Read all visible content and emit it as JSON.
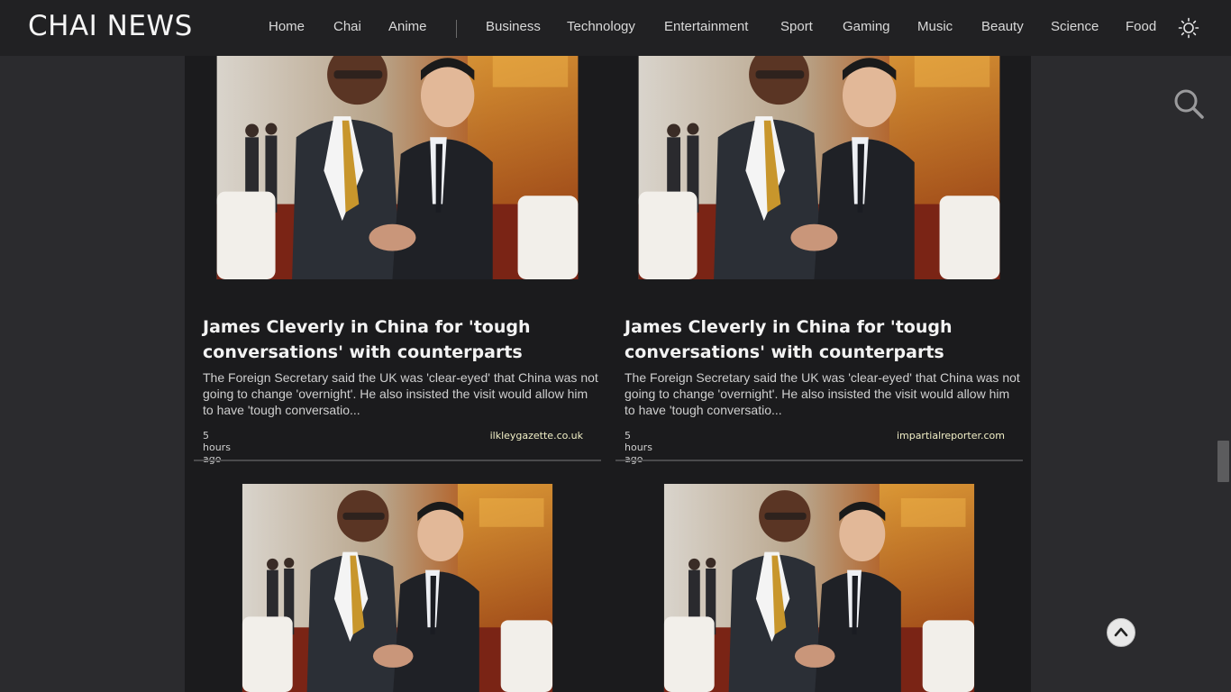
{
  "header": {
    "logo": "CHAI NEWS",
    "nav": [
      {
        "label": "Home"
      },
      {
        "label": "Chai"
      },
      {
        "label": "Anime"
      },
      {
        "label": "Business"
      },
      {
        "label": "Technology"
      },
      {
        "label": "Entertainment"
      },
      {
        "label": "Sport"
      },
      {
        "label": "Gaming"
      },
      {
        "label": "Music"
      },
      {
        "label": "Beauty"
      },
      {
        "label": "Science"
      },
      {
        "label": "Food"
      }
    ],
    "theme_icon": "sun-icon"
  },
  "search": {
    "icon": "search-icon"
  },
  "cards": [
    {
      "title": "James Cleverly in China for 'tough conversations' with counterparts",
      "description": "The Foreign Secretary said the UK was 'clear-eyed' that China was not going to change 'overnight'. He also insisted the visit would allow him to have 'tough conversatio...",
      "time": "5 hours ago",
      "source": "ilkleygazette.co.uk"
    },
    {
      "title": "James Cleverly in China for 'tough conversations' with counterparts",
      "description": "The Foreign Secretary said the UK was 'clear-eyed' that China was not going to change 'overnight'. He also insisted the visit would allow him to have 'tough conversatio...",
      "time": "5 hours ago",
      "source": "impartialreporter.com"
    },
    {
      "title": "",
      "description": "",
      "time": "",
      "source": ""
    },
    {
      "title": "",
      "description": "",
      "time": "",
      "source": ""
    }
  ],
  "scroll_to_top": {
    "icon": "chevron-up-icon"
  },
  "colors": {
    "page_bg": "#2b2b2e",
    "header_bg": "#212123",
    "content_bg": "#1b1b1d",
    "source_text": "#f1efc6"
  }
}
